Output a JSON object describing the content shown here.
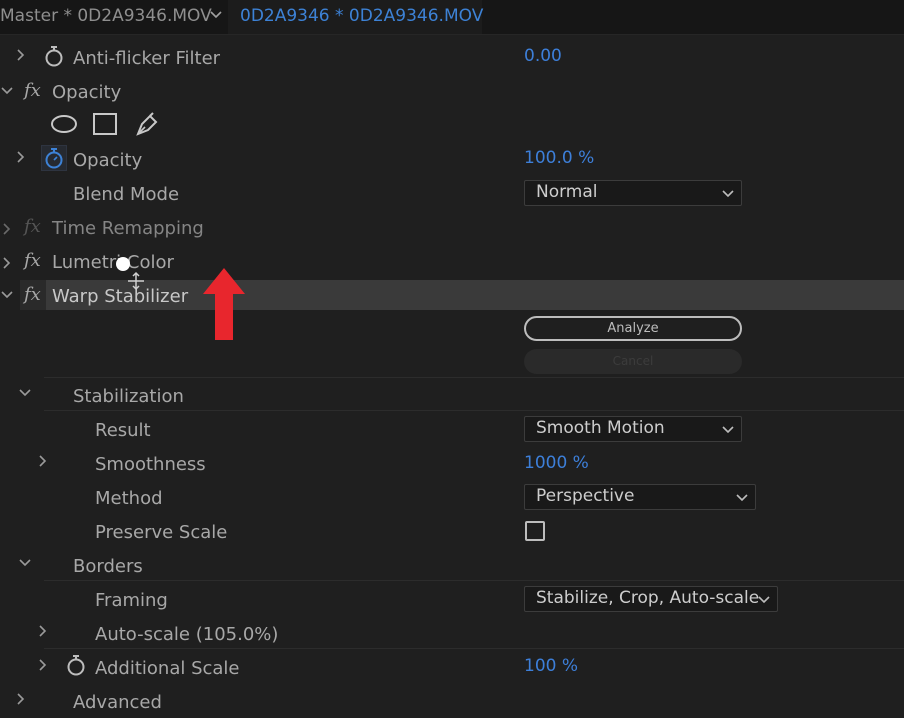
{
  "tabs": {
    "master_tab": "Master * 0D2A9346.MOV",
    "clip_tab": "0D2A9346 * 0D2A9346.MOV"
  },
  "rows": {
    "anti_flicker_label": "Anti-flicker Filter",
    "anti_flicker_value": "0.00",
    "opacity_section_label": "Opacity",
    "opacity_prop_label": "Opacity",
    "opacity_value": "100.0 %",
    "blend_mode_label": "Blend Mode",
    "blend_mode_value": "Normal",
    "time_remapping_label": "Time Remapping",
    "lumetri_label": "Lumetri Color",
    "warp_label": "Warp Stabilizer",
    "analyze_label": "Analyze",
    "cancel_label": "Cancel",
    "stabilization_label": "Stabilization",
    "result_label": "Result",
    "result_value": "Smooth Motion",
    "smoothness_label": "Smoothness",
    "smoothness_value": "1000 %",
    "method_label": "Method",
    "method_value": "Perspective",
    "preserve_scale_label": "Preserve Scale",
    "preserve_scale_checked": false,
    "borders_label": "Borders",
    "framing_label": "Framing",
    "framing_value": "Stabilize, Crop, Auto-scale",
    "auto_scale_label": "Auto-scale (105.0%)",
    "additional_scale_label": "Additional Scale",
    "additional_scale_value": "100 %",
    "advanced_label": "Advanced"
  },
  "fx_glyph": "fx",
  "colors": {
    "value_blue": "#3d7fd9",
    "annotation_red": "#e8262d",
    "selected_row": "#3a3a3a"
  },
  "icons": {
    "stopwatch": "stopwatch-icon",
    "mask_ellipse": "ellipse-mask-icon",
    "mask_rect": "rectangle-mask-icon",
    "mask_pen": "pen-mask-icon"
  }
}
